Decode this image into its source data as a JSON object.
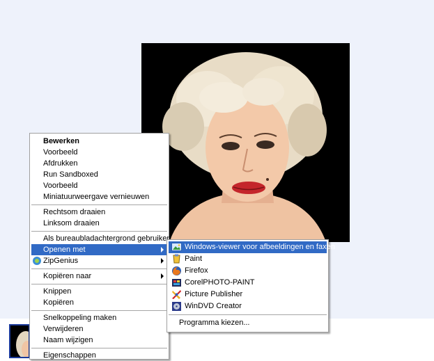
{
  "context_menu": {
    "items": [
      {
        "label": "Bewerken"
      },
      {
        "label": "Voorbeeld"
      },
      {
        "label": "Afdrukken"
      },
      {
        "label": "Run Sandboxed"
      },
      {
        "label": "Voorbeeld"
      },
      {
        "label": "Miniatuurweergave vernieuwen"
      },
      {
        "label": "Rechtsom draaien"
      },
      {
        "label": "Linksom draaien"
      },
      {
        "label": "Als bureaubladachtergrond gebruiken"
      },
      {
        "label": "Openen met"
      },
      {
        "label": "ZipGenius"
      },
      {
        "label": "Kopiëren naar"
      },
      {
        "label": "Knippen"
      },
      {
        "label": "Kopiëren"
      },
      {
        "label": "Snelkoppeling maken"
      },
      {
        "label": "Verwijderen"
      },
      {
        "label": "Naam wijzigen"
      },
      {
        "label": "Eigenschappen"
      }
    ]
  },
  "open_with_submenu": {
    "items": [
      {
        "label": "Windows-viewer voor afbeeldingen en faxen",
        "icon": "image-viewer-icon"
      },
      {
        "label": "Paint",
        "icon": "paint-icon"
      },
      {
        "label": "Firefox",
        "icon": "firefox-icon"
      },
      {
        "label": "CorelPHOTO-PAINT",
        "icon": "corel-icon"
      },
      {
        "label": "Picture Publisher",
        "icon": "picture-publisher-icon"
      },
      {
        "label": "WinDVD Creator",
        "icon": "windvd-icon"
      },
      {
        "label": "Programma kiezen..."
      }
    ]
  },
  "colors": {
    "highlight": "#316ac5",
    "desktop_background": "#eef2fb"
  }
}
